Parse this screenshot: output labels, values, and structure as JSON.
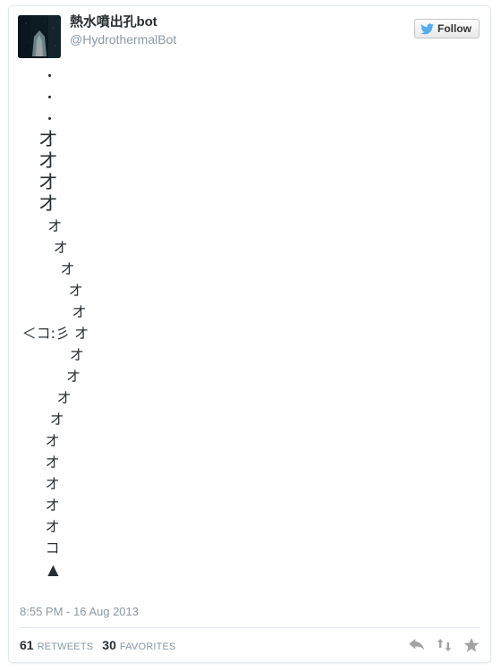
{
  "card": {
    "type": "embedded-tweet"
  },
  "header": {
    "full_name": "熱水噴出孔bot",
    "screen_name": "@HydrothermalBot",
    "avatar_alt": "hydrothermal-vent-photo",
    "follow_label": "Follow",
    "follow_icon": "twitter-bird-icon",
    "brand_blue": "#55acee"
  },
  "tweet": {
    "art_lines": [
      {
        "text": "・",
        "indent": 2.0,
        "size": 15
      },
      {
        "text": "・",
        "indent": 2.0,
        "size": 15
      },
      {
        "text": "・",
        "indent": 2.0,
        "size": 15
      },
      {
        "text": "オ",
        "indent": 1.6,
        "size": 22
      },
      {
        "text": "オ",
        "indent": 1.6,
        "size": 22
      },
      {
        "text": "オ",
        "indent": 1.6,
        "size": 22
      },
      {
        "text": "オ",
        "indent": 1.6,
        "size": 22
      },
      {
        "text": "オ",
        "indent": 2.4,
        "size": 16
      },
      {
        "text": "オ",
        "indent": 2.9,
        "size": 16
      },
      {
        "text": "オ",
        "indent": 3.5,
        "size": 16
      },
      {
        "text": "オ",
        "indent": 4.2,
        "size": 16
      },
      {
        "text": "オ",
        "indent": 4.5,
        "size": 16
      },
      {
        "text": "＜コ:彡 オ",
        "indent": 0.2,
        "size": 16
      },
      {
        "text": "オ",
        "indent": 4.3,
        "size": 16
      },
      {
        "text": "オ",
        "indent": 4.0,
        "size": 16
      },
      {
        "text": "オ",
        "indent": 3.2,
        "size": 16
      },
      {
        "text": "オ",
        "indent": 2.6,
        "size": 16
      },
      {
        "text": "オ",
        "indent": 2.2,
        "size": 16
      },
      {
        "text": "オ",
        "indent": 2.2,
        "size": 16
      },
      {
        "text": "オ",
        "indent": 2.2,
        "size": 16
      },
      {
        "text": "オ",
        "indent": 2.2,
        "size": 16
      },
      {
        "text": "オ",
        "indent": 2.2,
        "size": 16
      },
      {
        "text": "コ",
        "indent": 2.2,
        "size": 16
      },
      {
        "text": "▲",
        "indent": 2.4,
        "size": 16
      }
    ]
  },
  "footer": {
    "timestamp": "8:55 PM - 16 Aug 2013",
    "retweet_count": "61",
    "retweet_label": "RETWEETS",
    "favorite_count": "30",
    "favorite_label": "FAVORITES",
    "actions": [
      {
        "name": "reply-icon"
      },
      {
        "name": "retweet-icon"
      },
      {
        "name": "favorite-icon"
      }
    ]
  }
}
